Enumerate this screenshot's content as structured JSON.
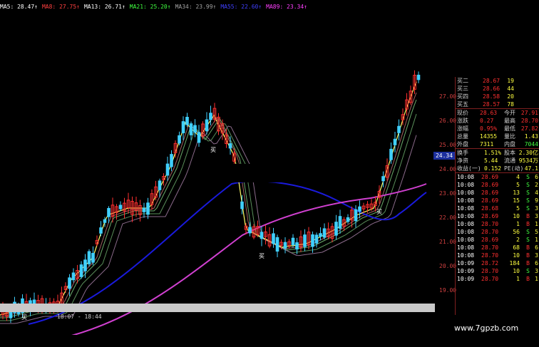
{
  "ma_indicators": [
    {
      "label": "MA5: 28.47",
      "color": "#ffffff"
    },
    {
      "label": "MA8: 27.75",
      "color": "#ff4040"
    },
    {
      "label": "MA13: 26.71",
      "color": "#ffffff"
    },
    {
      "label": "MA21: 25.20",
      "color": "#40ff40"
    },
    {
      "label": "MA34: 23.99",
      "color": "#a0a0a0"
    },
    {
      "label": "MA55: 22.60",
      "color": "#4040ff"
    },
    {
      "label": "MA89: 23.34",
      "color": "#ff40ff"
    }
  ],
  "price_ticks": [
    "27.00",
    "26.00",
    "25.00",
    "24.00",
    "23.00",
    "22.00",
    "21.00",
    "20.00",
    "19.00"
  ],
  "current_price_marker": "24.34",
  "quote_panel": {
    "order_book": [
      {
        "label": "买二",
        "price": "28.67",
        "vol": "19"
      },
      {
        "label": "买三",
        "price": "28.66",
        "vol": "44"
      },
      {
        "label": "买四",
        "price": "28.58",
        "vol": "20"
      },
      {
        "label": "买五",
        "price": "28.57",
        "vol": "78"
      }
    ],
    "stats": [
      {
        "l1": "现价",
        "v1": "28.63",
        "l2": "今开",
        "v2": "27.91"
      },
      {
        "l1": "涨跌",
        "v1": "0.27",
        "l2": "最高",
        "v2": "28.70"
      },
      {
        "l1": "涨幅",
        "v1": "0.95%",
        "l2": "最低",
        "v2": "27.82"
      },
      {
        "l1": "总量",
        "v1": "14355",
        "l2": "量比",
        "v2": "1.43"
      },
      {
        "l1": "外盘",
        "v1": "7311",
        "l2": "内盘",
        "v2": "7044"
      }
    ],
    "fundamentals": [
      {
        "l1": "换手",
        "v1": "1.51%",
        "l2": "股本",
        "v2": "2.30亿"
      },
      {
        "l1": "净资",
        "v1": "5.44",
        "l2": "流通",
        "v2": "9534万"
      },
      {
        "l1": "收益(一)",
        "v1": "0.152",
        "l2": "PE(动)",
        "v2": "47.1"
      }
    ],
    "ticks": [
      {
        "time": "10:08",
        "price": "28.69",
        "vol": "4",
        "side": "S",
        "n": "6"
      },
      {
        "time": "10:08",
        "price": "28.69",
        "vol": "5",
        "side": "S",
        "n": "2"
      },
      {
        "time": "10:08",
        "price": "28.69",
        "vol": "13",
        "side": "S",
        "n": "4"
      },
      {
        "time": "10:08",
        "price": "28.69",
        "vol": "15",
        "side": "S",
        "n": "9"
      },
      {
        "time": "10:08",
        "price": "28.68",
        "vol": "5",
        "side": "S",
        "n": "3"
      },
      {
        "time": "10:08",
        "price": "28.69",
        "vol": "10",
        "side": "B",
        "n": "3"
      },
      {
        "time": "10:08",
        "price": "28.70",
        "vol": "1",
        "side": "B",
        "n": "1"
      },
      {
        "time": "10:08",
        "price": "28.70",
        "vol": "56",
        "side": "S",
        "n": "5"
      },
      {
        "time": "10:08",
        "price": "28.69",
        "vol": "2",
        "side": "S",
        "n": "1"
      },
      {
        "time": "10:08",
        "price": "28.70",
        "vol": "68",
        "side": "B",
        "n": "6"
      },
      {
        "time": "10:08",
        "price": "28.70",
        "vol": "10",
        "side": "B",
        "n": "3"
      },
      {
        "time": "10:09",
        "price": "28.72",
        "vol": "184",
        "side": "B",
        "n": "6"
      },
      {
        "time": "10:09",
        "price": "28.70",
        "vol": "10",
        "side": "S",
        "n": "3"
      },
      {
        "time": "10:09",
        "price": "28.70",
        "vol": "1",
        "side": "B",
        "n": "1"
      }
    ]
  },
  "buy_signal_label": "买",
  "time_label": "18:07 - 18:44",
  "watermark": "www.7gpzb.com",
  "colors": {
    "up_candle": "#ff3030",
    "down_candle": "#40d0ff",
    "ma5": "#ffff66",
    "ma55": "#1a1adc",
    "ma89": "#d040d0",
    "panel_red": "#ff3030",
    "panel_green": "#40ff40",
    "panel_yellow": "#ffff40"
  }
}
